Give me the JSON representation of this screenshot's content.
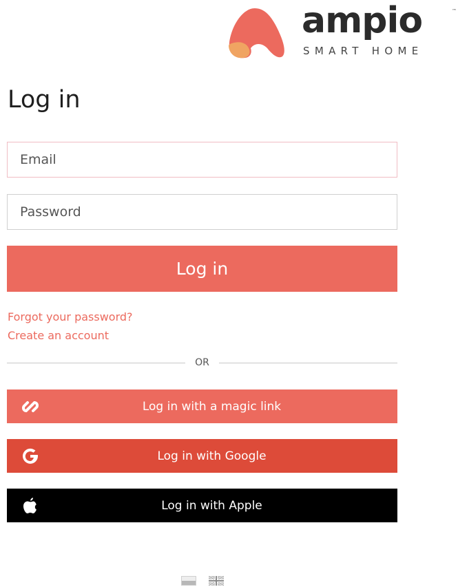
{
  "brand": {
    "wordmark": "ampio",
    "tagline": "SMART HOME",
    "trademark": "™",
    "colors": {
      "primary": "#ec6a5e",
      "secondary": "#f0a462",
      "google": "#dd4b39",
      "apple": "#000000"
    }
  },
  "page": {
    "title": "Log in"
  },
  "form": {
    "email_placeholder": "Email",
    "password_placeholder": "Password",
    "email_value": "",
    "password_value": "",
    "submit_label": "Log in"
  },
  "links": {
    "forgot_password": "Forgot your password?",
    "create_account": "Create an account"
  },
  "divider": {
    "label": "OR"
  },
  "social": {
    "magic_link": {
      "label": "Log in with a magic link",
      "icon": "link-icon"
    },
    "google": {
      "label": "Log in with Google",
      "icon": "google-icon"
    },
    "apple": {
      "label": "Log in with Apple",
      "icon": "apple-icon"
    }
  },
  "languages": [
    {
      "code": "pl",
      "icon": "poland-flag-icon"
    },
    {
      "code": "en",
      "icon": "uk-flag-icon"
    }
  ]
}
